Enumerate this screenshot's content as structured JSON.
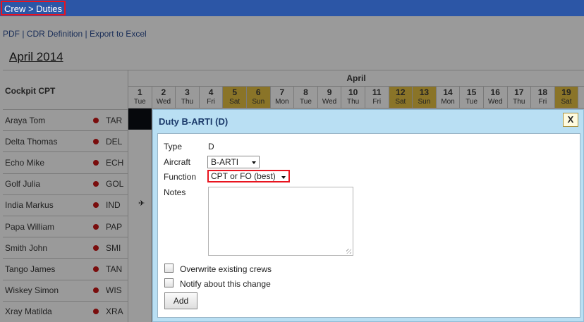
{
  "header": {
    "breadcrumb": "Crew > Duties"
  },
  "links": {
    "pdf": "PDF",
    "cdr": "CDR Definition",
    "excel": "Export to Excel",
    "sep": " | "
  },
  "calendar": {
    "title": "April 2014",
    "group_label": "Cockpit CPT",
    "month_label": "April",
    "days": [
      {
        "num": "1",
        "name": "Tue",
        "weekend": false
      },
      {
        "num": "2",
        "name": "Wed",
        "weekend": false
      },
      {
        "num": "3",
        "name": "Thu",
        "weekend": false
      },
      {
        "num": "4",
        "name": "Fri",
        "weekend": false
      },
      {
        "num": "5",
        "name": "Sat",
        "weekend": true
      },
      {
        "num": "6",
        "name": "Sun",
        "weekend": true
      },
      {
        "num": "7",
        "name": "Mon",
        "weekend": false
      },
      {
        "num": "8",
        "name": "Tue",
        "weekend": false
      },
      {
        "num": "9",
        "name": "Wed",
        "weekend": false
      },
      {
        "num": "10",
        "name": "Thu",
        "weekend": false
      },
      {
        "num": "11",
        "name": "Fri",
        "weekend": false
      },
      {
        "num": "12",
        "name": "Sat",
        "weekend": true
      },
      {
        "num": "13",
        "name": "Sun",
        "weekend": true
      },
      {
        "num": "14",
        "name": "Mon",
        "weekend": false
      },
      {
        "num": "15",
        "name": "Tue",
        "weekend": false
      },
      {
        "num": "16",
        "name": "Wed",
        "weekend": false
      },
      {
        "num": "17",
        "name": "Thu",
        "weekend": false
      },
      {
        "num": "18",
        "name": "Fri",
        "weekend": false
      },
      {
        "num": "19",
        "name": "Sat",
        "weekend": true
      }
    ],
    "crew": [
      {
        "name": "Araya Tom",
        "code": "TAR"
      },
      {
        "name": "Delta Thomas",
        "code": "DEL"
      },
      {
        "name": "Echo Mike",
        "code": "ECH"
      },
      {
        "name": "Golf Julia",
        "code": "GOL"
      },
      {
        "name": "India Markus",
        "code": "IND"
      },
      {
        "name": "Papa William",
        "code": "PAP"
      },
      {
        "name": "Smith John",
        "code": "SMI"
      },
      {
        "name": "Tango James",
        "code": "TAN"
      },
      {
        "name": "Wiskey Simon",
        "code": "WIS"
      },
      {
        "name": "Xray Matilda",
        "code": "XRA"
      }
    ]
  },
  "dialog": {
    "title": "Duty B-ARTI (D)",
    "close_label": "X",
    "type_label": "Type",
    "type_value": "D",
    "aircraft_label": "Aircraft",
    "aircraft_value": "B-ARTI",
    "function_label": "Function",
    "function_value": "CPT or FO (best)",
    "notes_label": "Notes",
    "notes_value": "",
    "overwrite_label": "Overwrite existing crews",
    "notify_label": "Notify about this change",
    "add_label": "Add"
  },
  "colors": {
    "topbar": "#2c56a6",
    "highlight": "#e8141f",
    "weekend": "#8a7428",
    "dialog_bg": "#b9dff3"
  },
  "icons": {
    "status_dot": "red-dot-icon",
    "plane": "plane-icon"
  }
}
